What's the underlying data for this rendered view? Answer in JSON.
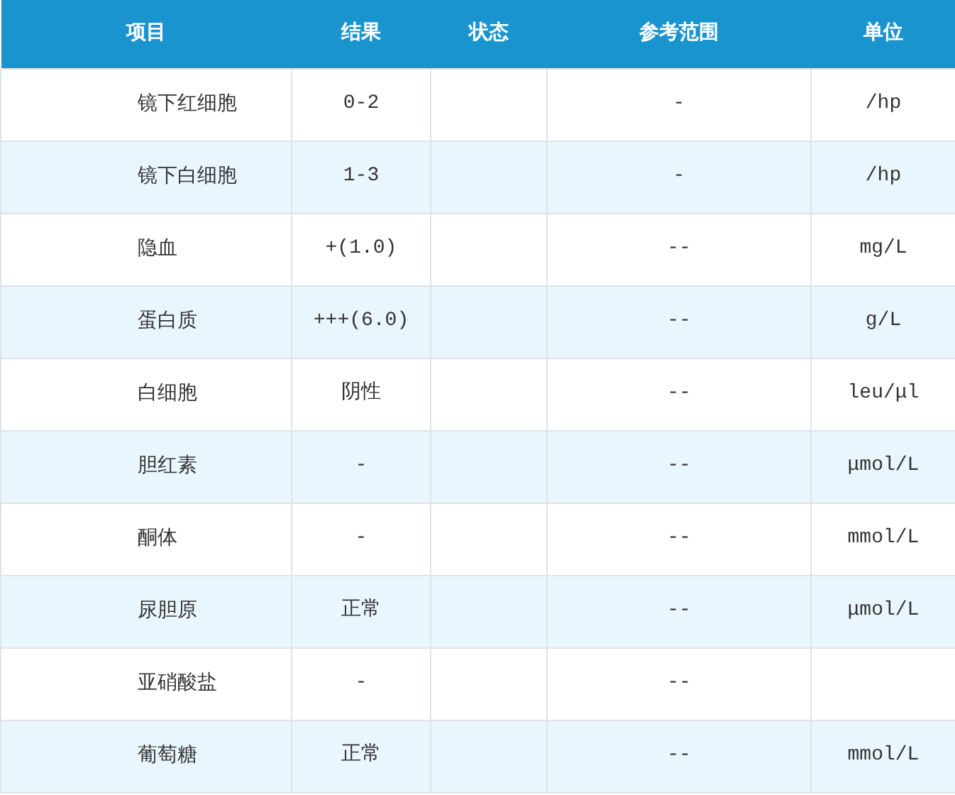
{
  "table": {
    "columns": [
      "项目",
      "结果",
      "状态",
      "参考范围",
      "单位"
    ],
    "rows": [
      {
        "item": "镜下红细胞",
        "result": "0-2",
        "range": "-",
        "unit": "/hp"
      },
      {
        "item": "镜下白细胞",
        "result": "1-3",
        "range": "-",
        "unit": "/hp"
      },
      {
        "item": "隐血",
        "result": "+(1.0)",
        "range": "--",
        "unit": "mg/L"
      },
      {
        "item": "蛋白质",
        "result": "+++(6.0)",
        "range": "--",
        "unit": "g/L"
      },
      {
        "item": "白细胞",
        "result": "阴性",
        "range": "--",
        "unit": "leu/μl"
      },
      {
        "item": "胆红素",
        "result": "-",
        "range": "--",
        "unit": "μmol/L"
      },
      {
        "item": "酮体",
        "result": "-",
        "range": "--",
        "unit": "mmol/L"
      },
      {
        "item": "尿胆原",
        "result": "正常",
        "range": "--",
        "unit": "μmol/L"
      },
      {
        "item": "亚硝酸盐",
        "result": "-",
        "range": "--"
      },
      {
        "item": "葡萄糖",
        "result": "正常",
        "range": "--",
        "unit": "mmol/L"
      }
    ]
  }
}
